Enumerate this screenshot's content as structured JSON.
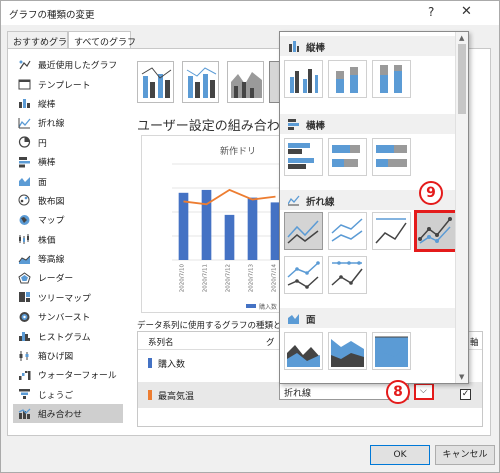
{
  "window": {
    "title": "グラフの種類の変更",
    "help": "?",
    "close": "✕"
  },
  "tabs": [
    "おすすめグラフ",
    "すべてのグラフ"
  ],
  "sidebar": {
    "items": [
      {
        "label": "最近使用したグラフ",
        "icon": "recent-icon"
      },
      {
        "label": "テンプレート",
        "icon": "template-icon"
      },
      {
        "label": "縦棒",
        "icon": "column-icon"
      },
      {
        "label": "折れ線",
        "icon": "line-icon"
      },
      {
        "label": "円",
        "icon": "pie-icon"
      },
      {
        "label": "横棒",
        "icon": "bar-icon"
      },
      {
        "label": "面",
        "icon": "area-icon"
      },
      {
        "label": "散布図",
        "icon": "scatter-icon"
      },
      {
        "label": "マップ",
        "icon": "map-icon"
      },
      {
        "label": "株価",
        "icon": "stock-icon"
      },
      {
        "label": "等高線",
        "icon": "surface-icon"
      },
      {
        "label": "レーダー",
        "icon": "radar-icon"
      },
      {
        "label": "ツリーマップ",
        "icon": "treemap-icon"
      },
      {
        "label": "サンバースト",
        "icon": "sunburst-icon"
      },
      {
        "label": "ヒストグラム",
        "icon": "histogram-icon"
      },
      {
        "label": "箱ひげ図",
        "icon": "boxwhisker-icon"
      },
      {
        "label": "ウォーターフォール",
        "icon": "waterfall-icon"
      },
      {
        "label": "じょうご",
        "icon": "funnel-icon"
      },
      {
        "label": "組み合わせ",
        "icon": "combo-icon"
      }
    ],
    "selected_index": 18
  },
  "main": {
    "heading": "ユーザー設定の組み合わせ",
    "preview": {
      "title": "新作ドリ",
      "legend": "購入数"
    },
    "series_label": "データ系列に使用するグラフの種類と軸",
    "table": {
      "col_series": "系列名",
      "col_type": "グ",
      "col_axis": "軸",
      "rows": [
        {
          "name": "購入数",
          "color": "#4472c4",
          "checked": false
        },
        {
          "name": "最高気温",
          "color": "#ed7d31",
          "checked": true
        }
      ]
    },
    "combo_value": "折れ線"
  },
  "dropdown": {
    "sections": [
      {
        "label": "縦棒",
        "icon": "column-icon"
      },
      {
        "label": "横棒",
        "icon": "bar-icon"
      },
      {
        "label": "折れ線",
        "icon": "line-icon"
      },
      {
        "label": "面",
        "icon": "area-icon"
      }
    ]
  },
  "chart_data": {
    "type": "bar",
    "title": "新作ドリ",
    "categories": [
      "2020/7/10",
      "2020/7/11",
      "2020/7/12",
      "2020/7/13",
      "2020/7/14"
    ],
    "series": [
      {
        "name": "購入数",
        "type": "bar",
        "values": [
          70,
          73,
          47,
          65,
          60
        ],
        "color": "#4472c4"
      },
      {
        "type": "line",
        "values": [
          61,
          58,
          73,
          63,
          66
        ],
        "color": "#ed7d31"
      }
    ],
    "ylim": [
      0,
      100
    ]
  },
  "badges": {
    "step8": "8",
    "step9": "9"
  },
  "buttons": {
    "ok": "OK",
    "cancel": "キャンセル"
  },
  "colors": {
    "accent_red": "#e41b1b",
    "blue": "#4472c4",
    "orange": "#ed7d31",
    "light_blue": "#5b9bd5"
  }
}
